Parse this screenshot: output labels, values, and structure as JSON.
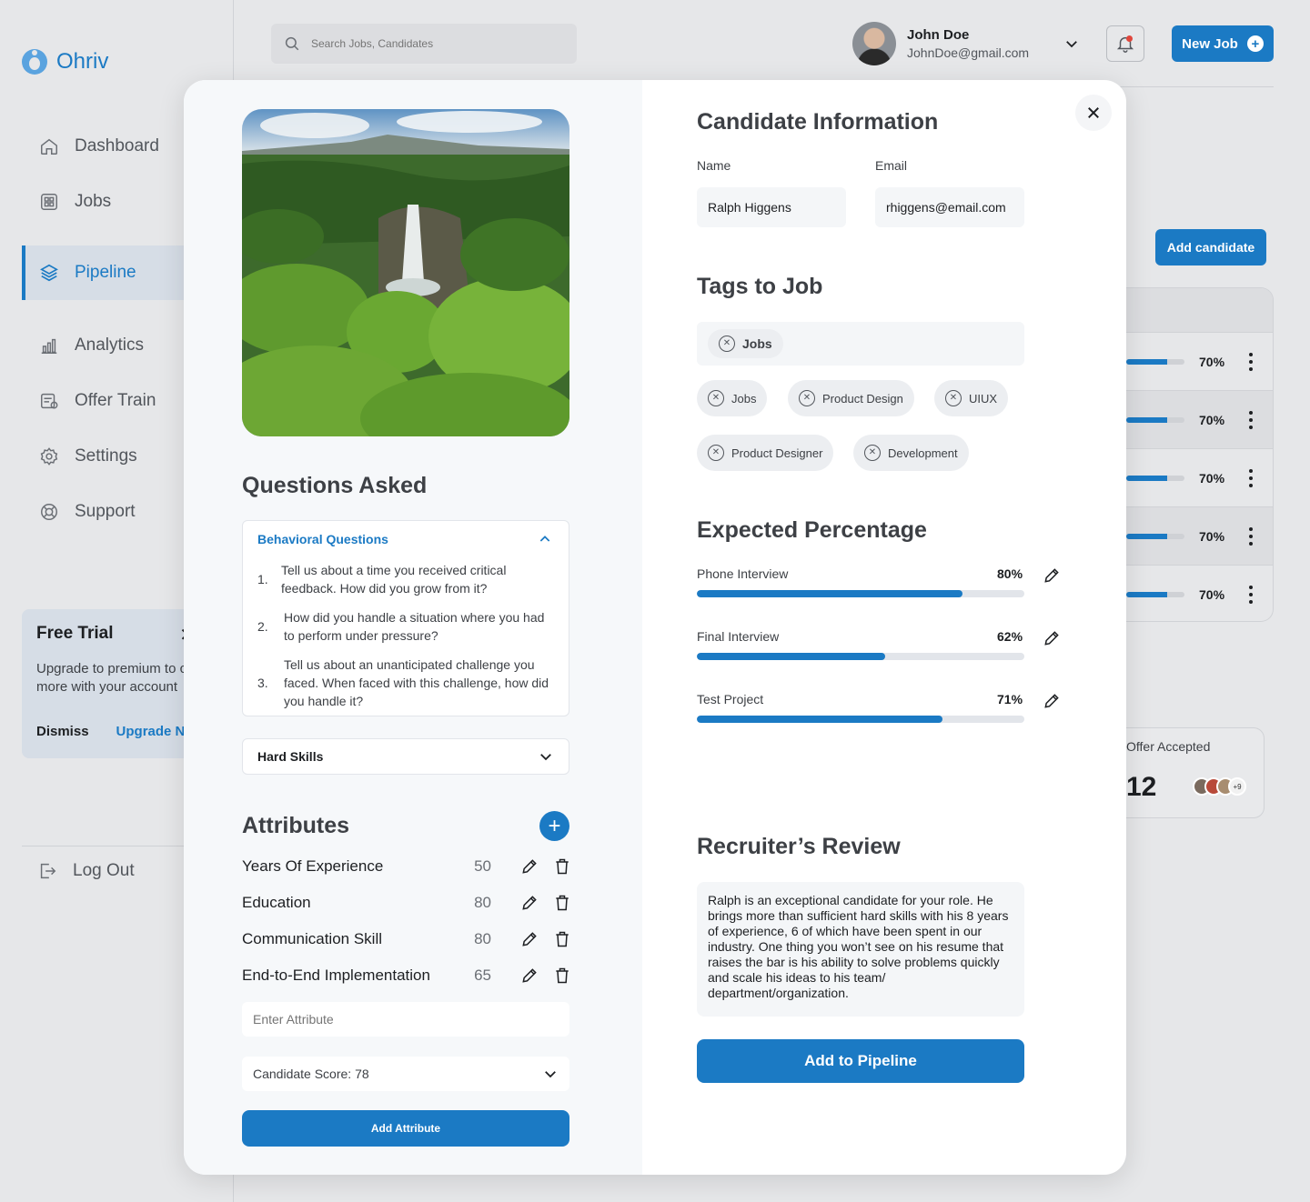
{
  "app": {
    "name": "Ohriv"
  },
  "sidebar": {
    "items": [
      {
        "label": "Dashboard",
        "icon": "home-icon"
      },
      {
        "label": "Jobs",
        "icon": "grid-icon"
      },
      {
        "label": "Pipeline",
        "icon": "layers-icon",
        "active": true
      },
      {
        "label": "Analytics",
        "icon": "bar-chart-icon"
      },
      {
        "label": "Offer Train",
        "icon": "document-icon"
      },
      {
        "label": "Settings",
        "icon": "gear-icon"
      },
      {
        "label": "Support",
        "icon": "lifebuoy-icon"
      }
    ],
    "trial": {
      "title": "Free Trial",
      "text_line1": "Upgrade to premium to c",
      "text_line2": "more with your account",
      "dismiss": "Dismiss",
      "upgrade": "Upgrade No"
    },
    "logout": "Log Out"
  },
  "topbar": {
    "search_placeholder": "Search Jobs, Candidates",
    "user_name": "John Doe",
    "user_email": "JohnDoe@gmail.com",
    "new_job": "New Job"
  },
  "background": {
    "add_candidate": "Add candidate",
    "rows": [
      {
        "progress": 0.7,
        "pct": "70%"
      },
      {
        "progress": 0.7,
        "pct": "70%"
      },
      {
        "progress": 0.7,
        "pct": "70%"
      },
      {
        "progress": 0.7,
        "pct": "70%"
      },
      {
        "progress": 0.7,
        "pct": "70%"
      }
    ],
    "offer_card": {
      "label": "Offer Accepted",
      "value": "12",
      "more": "+9"
    }
  },
  "modal": {
    "questions": {
      "title": "Questions Asked",
      "group_title": "Behavioral Questions",
      "items": [
        {
          "num": "1.",
          "text": "Tell us about a time you received critical feedback. How did you grow from it?"
        },
        {
          "num": "2.",
          "text": "How did you handle a situation where you had to perform under pressure?"
        },
        {
          "num": "3.",
          "text": "Tell us about an unanticipated challenge you faced. When faced with this challenge, how did you handle it?"
        }
      ],
      "hard_skills": "Hard Skills"
    },
    "attributes": {
      "title": "Attributes",
      "items": [
        {
          "name": "Years Of Experience",
          "value": "50"
        },
        {
          "name": "Education",
          "value": "80"
        },
        {
          "name": "Communication Skill",
          "value": "80"
        },
        {
          "name": "End-to-End Implementation",
          "value": "65"
        }
      ],
      "input_placeholder": "Enter Attribute",
      "score": "Candidate Score: 78",
      "add_button": "Add Attribute"
    },
    "candidate": {
      "title": "Candidate Information",
      "name_label": "Name",
      "name_value": "Ralph Higgens",
      "email_label": "Email",
      "email_value": "rhiggens@email.com"
    },
    "tags": {
      "title": "Tags to Job",
      "selected": [
        "Jobs"
      ],
      "options": [
        "Jobs",
        "Product Design",
        "UIUX",
        "Product Designer",
        "Development"
      ]
    },
    "expected": {
      "title": "Expected Percentage",
      "items": [
        {
          "label": "Phone Interview",
          "pct": "80%",
          "value": 0.81
        },
        {
          "label": "Final Interview",
          "pct": "62%",
          "value": 0.575
        },
        {
          "label": "Test Project",
          "pct": "71%",
          "value": 0.75
        }
      ]
    },
    "review": {
      "title": "Recruiter’s Review",
      "text": "Ralph is an exceptional candidate for your role. He brings more than sufficient hard skills with his 8 years of experience, 6 of which have been spent in our industry.  One thing you won’t see on his resume that raises the bar is his ability to solve problems quickly and scale his ideas to his team/ department/organization."
    },
    "pipeline_button": "Add to Pipeline"
  },
  "colors": {
    "accent": "#1b7ac4",
    "panel": "#f6f8fa",
    "background": "#e6e7e9"
  }
}
